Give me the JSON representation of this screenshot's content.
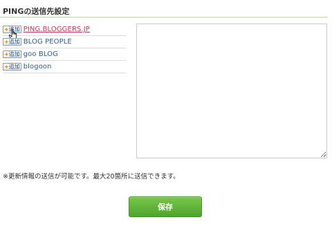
{
  "section": {
    "title": "PINGの送信先設定"
  },
  "ping_sites": [
    {
      "add_label": "追加",
      "name": "PING.BLOGGERS.JP",
      "hovered": true
    },
    {
      "add_label": "追加",
      "name": "BLOG PEOPLE",
      "hovered": false
    },
    {
      "add_label": "追加",
      "name": "goo BLOG",
      "hovered": false
    },
    {
      "add_label": "追加",
      "name": "blogoon",
      "hovered": false
    }
  ],
  "ping_textarea": {
    "value": ""
  },
  "note": "※更新情報の送信が可能です。最大20箇所に送信できます。",
  "save_button": {
    "label": "保存"
  },
  "colors": {
    "accent_green": "#5cb036",
    "link_blue": "#2a5d9a",
    "link_hover": "#cc3355",
    "title_rule": "#d7e8c4"
  },
  "icons": {
    "cursor": "hand-pointer-icon",
    "add": "plus-icon"
  }
}
